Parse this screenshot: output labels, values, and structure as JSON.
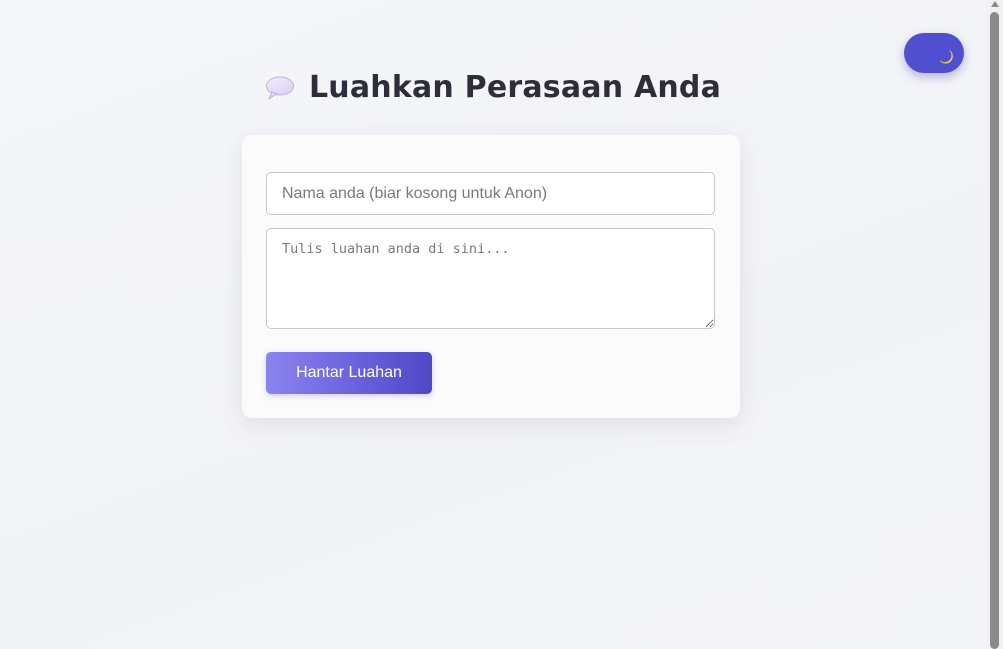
{
  "header": {
    "title_icon": "speech-bubble-icon",
    "title": "Luahkan Perasaan Anda"
  },
  "theme_toggle": {
    "icon": "moon-icon",
    "color": "#4f4fcf"
  },
  "form": {
    "name_placeholder": "Nama anda (biar kosong untuk Anon)",
    "name_value": "",
    "message_placeholder": "Tulis luahan anda di sini...",
    "message_value": "",
    "submit_label": "Hantar Luahan",
    "submit_gradient": [
      "#8b83ee",
      "#5048c4"
    ]
  }
}
